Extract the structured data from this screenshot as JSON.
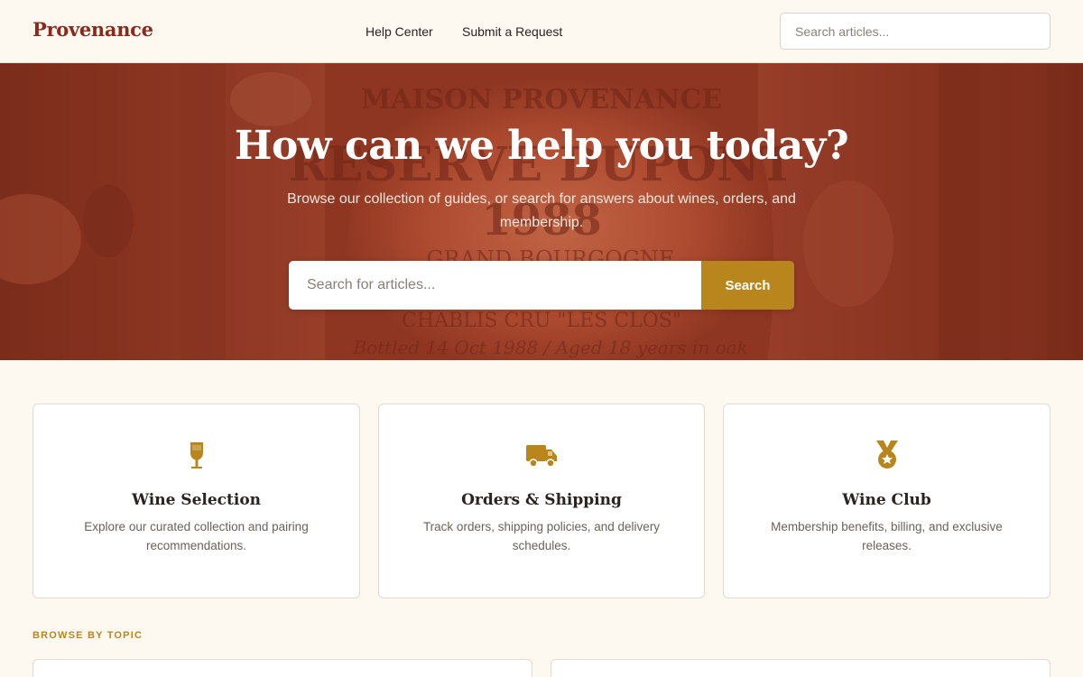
{
  "header": {
    "logo": "Provenance",
    "nav": [
      {
        "label": "Help Center"
      },
      {
        "label": "Submit a Request"
      }
    ],
    "search_placeholder": "Search articles..."
  },
  "hero": {
    "title": "How can we help you today?",
    "subtitle": "Browse our collection of guides, or search for answers about wines, orders, and membership.",
    "search_placeholder": "Search for articles...",
    "search_button": "Search",
    "label_text_lines": [
      "MAISON PROVENANCE",
      "RESERVE DUPONT",
      "1988",
      "GRAND BOURGOGNE",
      "CHABLIS CRU \"LES CLOS\"",
      "Bottled 14 Oct 1988 / Aged 18 years in oak"
    ]
  },
  "cards": [
    {
      "icon": "wine-glass-icon",
      "title": "Wine Selection",
      "description": "Explore our curated collection and pairing recommendations."
    },
    {
      "icon": "truck-icon",
      "title": "Orders & Shipping",
      "description": "Track orders, shipping policies, and delivery schedules."
    },
    {
      "icon": "medal-icon",
      "title": "Wine Club",
      "description": "Membership benefits, billing, and exclusive releases."
    }
  ],
  "browse": {
    "label": "BROWSE BY TOPIC"
  },
  "colors": {
    "brand": "#8a2a1c",
    "accent": "#b8861c",
    "background": "#fdf9f0"
  }
}
